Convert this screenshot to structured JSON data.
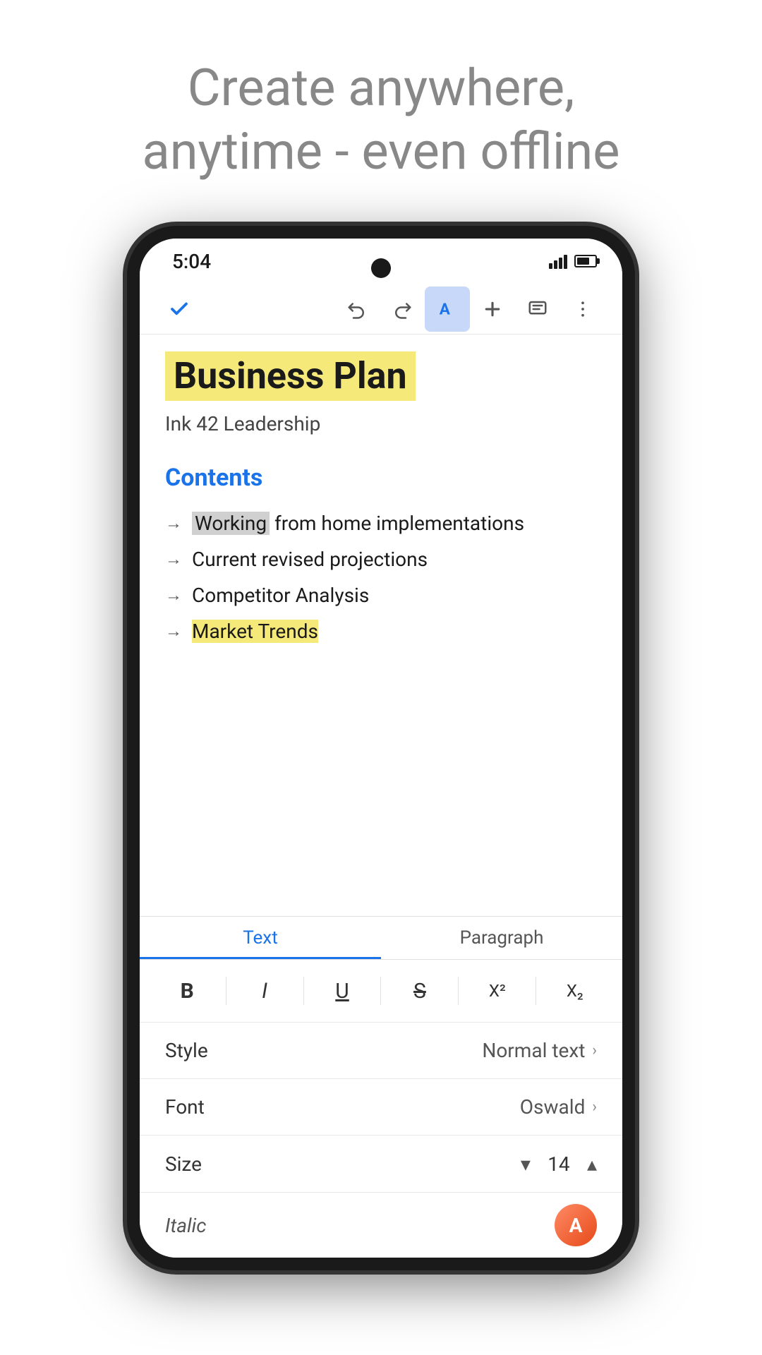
{
  "headline": {
    "line1": "Create anywhere,",
    "line2": "anytime - even offline"
  },
  "status_bar": {
    "time": "5:04",
    "signal": "signal",
    "battery": "battery"
  },
  "toolbar": {
    "check_label": "✓",
    "undo_label": "undo",
    "redo_label": "redo",
    "text_format_label": "A",
    "add_label": "+",
    "comment_label": "comment",
    "more_label": "⋮"
  },
  "document": {
    "title": "Business Plan",
    "subtitle": "Ink 42 Leadership",
    "heading": "Contents",
    "list_items": [
      {
        "text": "Working from home implementations",
        "highlight": "Working"
      },
      {
        "text": "Current revised projections",
        "highlight": ""
      },
      {
        "text": "Competitor Analysis",
        "highlight": ""
      },
      {
        "text": "Market Trends",
        "highlight": "Market Trends",
        "highlight_color": "yellow"
      }
    ]
  },
  "format_panel": {
    "tabs": [
      {
        "label": "Text",
        "active": true
      },
      {
        "label": "Paragraph",
        "active": false
      }
    ],
    "format_buttons": [
      {
        "label": "B",
        "type": "bold"
      },
      {
        "label": "I",
        "type": "italic"
      },
      {
        "label": "U",
        "type": "underline"
      },
      {
        "label": "S",
        "type": "strikethrough"
      },
      {
        "label": "X²",
        "type": "superscript"
      },
      {
        "label": "X₂",
        "type": "subscript"
      }
    ],
    "style_row": {
      "label": "Style",
      "value": "Normal text"
    },
    "font_row": {
      "label": "Font",
      "value": "Oswald"
    },
    "size_row": {
      "label": "Size",
      "value": "14",
      "chevron_down": "▾",
      "chevron_up": "▴"
    },
    "bottom_label": "Italic"
  }
}
